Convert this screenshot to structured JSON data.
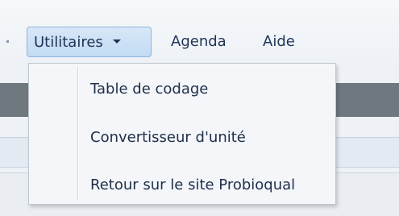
{
  "menubar": {
    "items": [
      {
        "label": "Utilitaires",
        "active": true
      },
      {
        "label": "Agenda"
      },
      {
        "label": "Aide"
      }
    ]
  },
  "dropdown": {
    "items": [
      {
        "label": "Table de codage"
      },
      {
        "label": "Convertisseur d'unité"
      },
      {
        "label": "Retour sur le site Probioqual"
      }
    ]
  },
  "colors": {
    "active_bg": "#c3dbf4",
    "active_border": "#8fb3dc",
    "dark_band": "#6f777f",
    "text": "#1f3355"
  }
}
